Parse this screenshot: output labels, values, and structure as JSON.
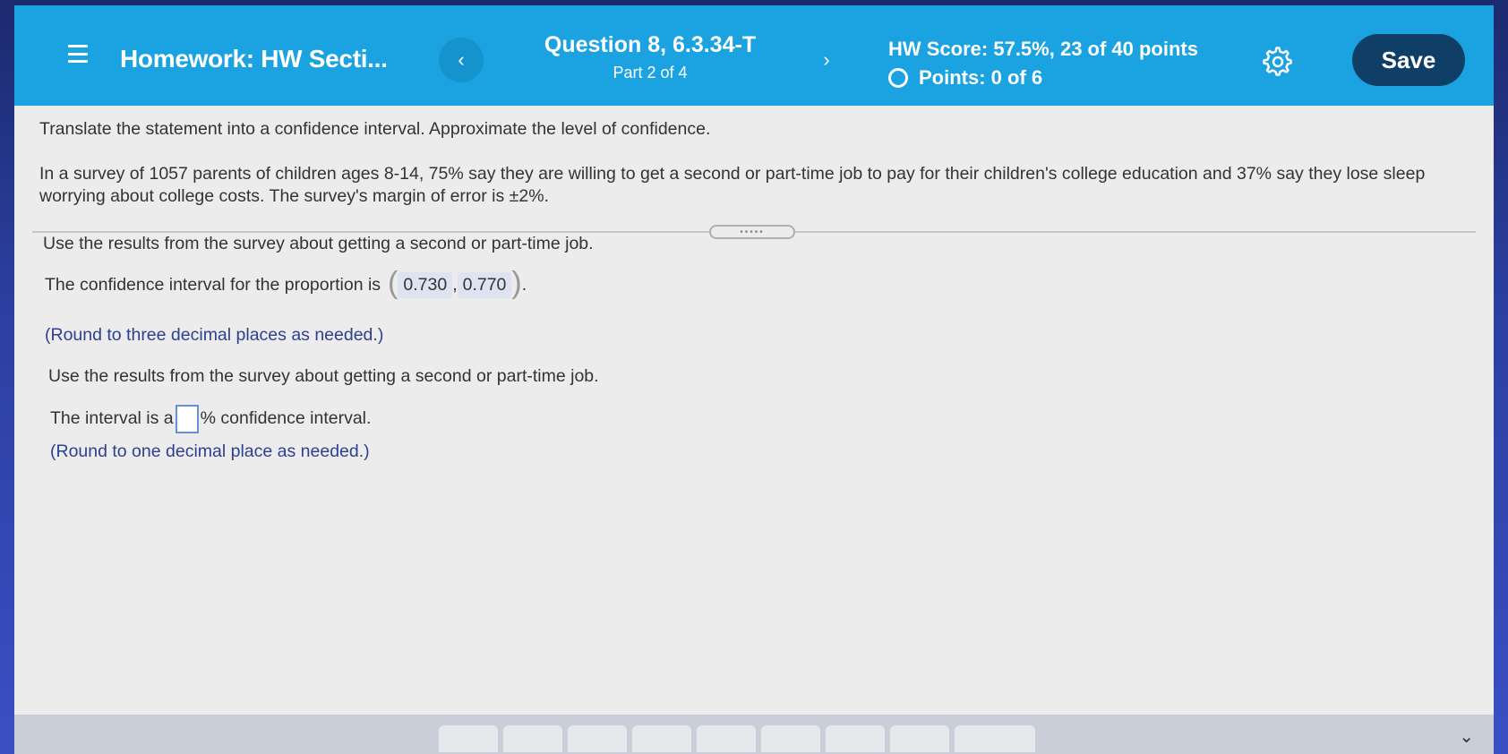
{
  "header": {
    "hw_title": "Homework: HW Secti...",
    "question_title": "Question 8, 6.3.34-T",
    "question_part": "Part 2 of 4",
    "hw_score": "HW Score: 57.5%, 23 of 40 points",
    "points": "Points: 0 of 6",
    "save_label": "Save",
    "prev_label": "‹",
    "next_label": "›"
  },
  "question": {
    "instruction": "Translate the statement into a confidence interval. Approximate the level of confidence.",
    "statement": "In a survey of 1057 parents of children ages 8-14, 75% say they are willing to get a second or part-time job to pay for their children's college education and 37% say they lose sleep worrying about college costs. The survey's margin of error is ±2%.",
    "part1_intro": "Use the results from the survey about getting a second or part-time job.",
    "part1_prompt": "The confidence interval for the proportion is",
    "part1_lower": "0.730",
    "part1_upper": "0.770",
    "part1_hint": "(Round to three decimal places as needed.)",
    "part2_intro": "Use the results from the survey about getting a second or part-time job.",
    "part2_prefix": "The interval is a",
    "part2_value": "",
    "part2_suffix": "% confidence interval.",
    "part2_hint": "(Round to one decimal place as needed.)"
  },
  "colors": {
    "header_bg": "#1aa3e0",
    "save_bg": "#0f3f66",
    "hint_text": "#2e3f92"
  }
}
